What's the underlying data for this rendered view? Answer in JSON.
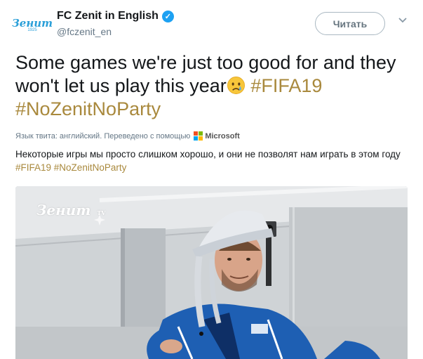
{
  "account": {
    "display_name": "FC Zenit in English",
    "handle": "@fczenit_en",
    "avatar_text": "Зенит",
    "avatar_year": "1925",
    "verified": true
  },
  "actions": {
    "follow_label": "Читать"
  },
  "tweet": {
    "text_part1": "Some games we're just too good for and they won't let us play this year",
    "hashtag1": "#FIFA19",
    "hashtag2": "#NoZenitNoParty"
  },
  "translation": {
    "meta": "Язык твита: английский. Переведено с помощью",
    "provider": "Microsoft",
    "text": "Некоторые игры мы просто слишком хорошо, и они не позволят нам играть в этом году",
    "unknown_char": "",
    "hashtag1": "#FIFA19",
    "hashtag2": "#NoZenitNoParty"
  },
  "media": {
    "watermark": "Зенит",
    "watermark_sub": "TV"
  },
  "colors": {
    "hashtag": "#a9893d",
    "verified": "#1da1f2",
    "zenit_blue": "#1d9bd8"
  }
}
